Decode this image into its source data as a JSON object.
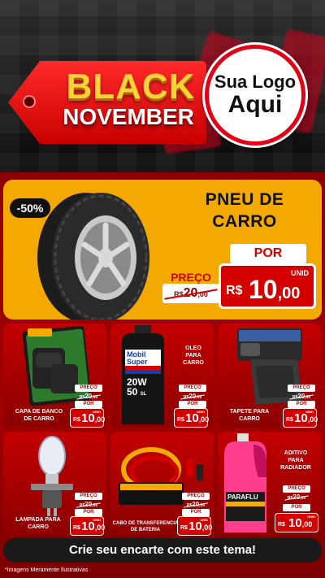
{
  "header": {
    "line1": "BLACK",
    "line2": "NOVEMBER",
    "logo_line1": "Sua Logo",
    "logo_line2": "Aqui"
  },
  "hero": {
    "discount": "-50%",
    "title_line1": "PNEU DE",
    "title_line2": "CARRO",
    "por_label": "POR",
    "preco_label": "PREÇO",
    "old_rs": "R$",
    "old_int": "20",
    "old_cents": ",00",
    "unid": "UNID",
    "rs": "R$",
    "price_int": "10",
    "price_cents": ",00",
    "colors": {
      "accent": "#f3a900",
      "red": "#d40000"
    }
  },
  "products": [
    {
      "title_lines": [
        "CAPA DE BANCO",
        "DE CARRO"
      ],
      "preco_label": "PREÇO",
      "old_rs": "R$",
      "old_int": "20",
      "old_cents": ",00",
      "por_label": "POR",
      "rs": "R$",
      "price_int": "10",
      "price_cents": ",00",
      "unid": "UNID",
      "icon": "seat-cover-package-icon",
      "package_text": [
        "CAPA PARA",
        "BANCOS",
        "PREMIUM"
      ]
    },
    {
      "title_lines": [
        "OLEO",
        "PARA",
        "CARRO"
      ],
      "preco_label": "PREÇO",
      "old_rs": "R$",
      "old_int": "20",
      "old_cents": ",00",
      "por_label": "POR",
      "rs": "R$",
      "price_int": "10",
      "price_cents": ",00",
      "unid": "UNID",
      "icon": "motor-oil-bottle-icon",
      "bottle_text": [
        "Mobil",
        "Super",
        "20W",
        "50",
        "SL"
      ]
    },
    {
      "title_lines": [
        "TAPETE PARA",
        "CARRO"
      ],
      "preco_label": "PREÇO",
      "old_rs": "R$",
      "old_int": "20",
      "old_cents": ",00",
      "por_label": "POR",
      "rs": "R$",
      "price_int": "10",
      "price_cents": ",00",
      "unid": "UNID",
      "icon": "car-mat-icon",
      "package_text": [
        "PREMIUM"
      ]
    },
    {
      "title_lines": [
        "LAMPADA PARA",
        "CARRO"
      ],
      "preco_label": "PREÇO",
      "old_rs": "R$",
      "old_int": "20",
      "old_cents": ",00",
      "por_label": "POR",
      "rs": "R$",
      "price_int": "10",
      "price_cents": ",00",
      "unid": "UNID",
      "icon": "headlight-bulb-icon"
    },
    {
      "title_lines": [
        "CABO DE TRANSFERENCIA",
        "DE BATERIA"
      ],
      "preco_label": "PREÇO",
      "old_rs": "R$",
      "old_int": "20",
      "old_cents": ",00",
      "por_label": "POR",
      "rs": "R$",
      "price_int": "10",
      "price_cents": ",00",
      "unid": "UNID",
      "icon": "jumper-cable-icon",
      "package_text": [
        "CABO PARA",
        "CARGA DE BATERIA"
      ]
    },
    {
      "title_lines": [
        "ADITIVO",
        "PARA",
        "RADIADOR"
      ],
      "preco_label": "PREÇO",
      "old_rs": "R$",
      "old_int": "20",
      "old_cents": ",00",
      "por_label": "POR",
      "rs": "R$",
      "price_int": "10",
      "price_cents": ",00",
      "unid": "UNID",
      "icon": "radiator-coolant-bottle-icon",
      "bottle_text": [
        "PARAFLU"
      ]
    }
  ],
  "footer": {
    "cta": "Crie seu encarte com este tema!",
    "note": "*Imagens Meramente Ilustrativas"
  }
}
